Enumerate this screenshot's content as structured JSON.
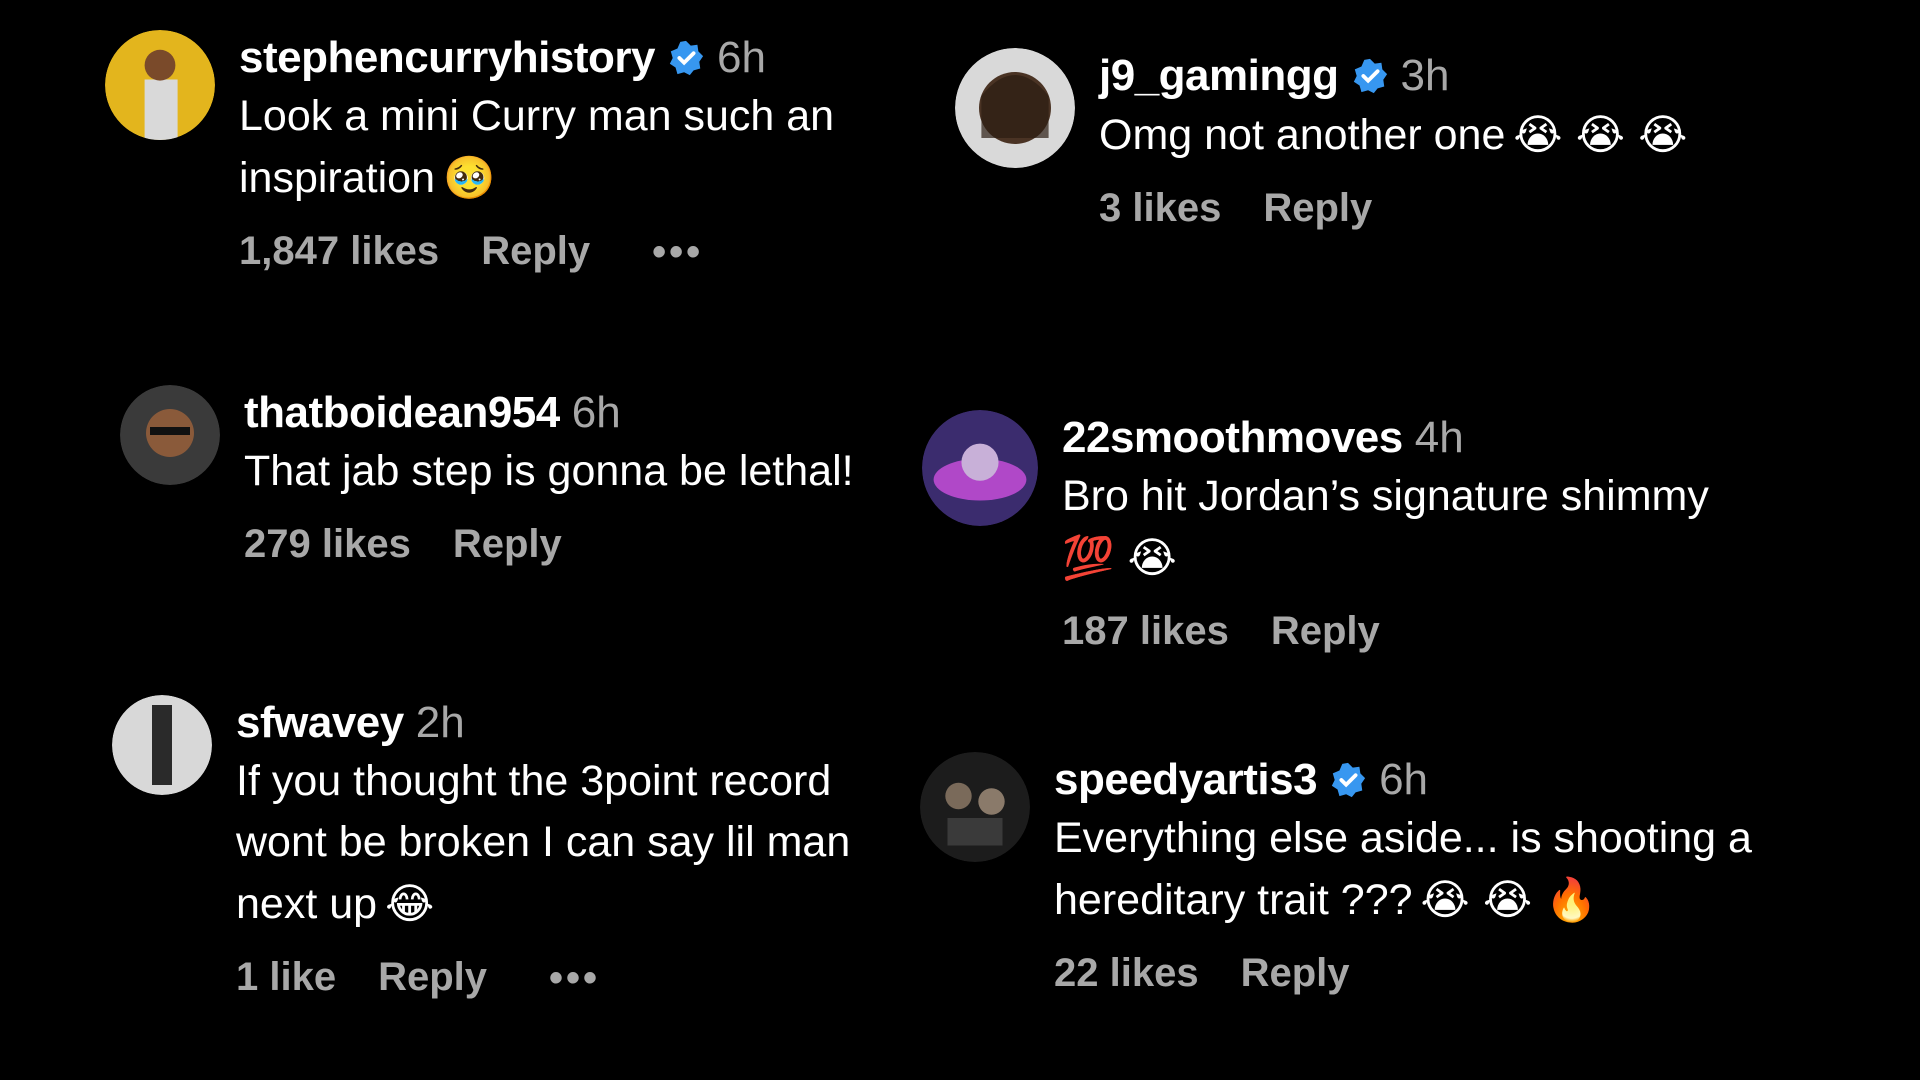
{
  "comments": [
    {
      "username": "stephencurryhistory",
      "verified": true,
      "time": "6h",
      "text": "Look a mini Curry man such an inspiration",
      "emojis": "🥹",
      "likes": "1,847 likes",
      "reply": "Reply",
      "more": "•••"
    },
    {
      "username": "thatboidean954",
      "verified": false,
      "time": "6h",
      "text": "That jab step is gonna be lethal!",
      "emojis": "",
      "likes": "279 likes",
      "reply": "Reply"
    },
    {
      "username": "sfwavey",
      "verified": false,
      "time": "2h",
      "text": "If you thought the 3point record wont be broken I can say lil man next up",
      "emojis": "😂",
      "likes": "1 like",
      "reply": "Reply",
      "more": "•••"
    },
    {
      "username": "j9_gamingg",
      "verified": true,
      "time": "3h",
      "text": "Omg not another one",
      "emojis": "😭 😭 😭",
      "likes": "3 likes",
      "reply": "Reply"
    },
    {
      "username": "22smoothmoves",
      "verified": false,
      "time": "4h",
      "text": "Bro hit Jordan’s signature shimmy",
      "emojis": "💯 😭",
      "likes": "187 likes",
      "reply": "Reply"
    },
    {
      "username": "speedyartis3",
      "verified": true,
      "time": "6h",
      "text": "Everything else aside... is shooting a hereditary trait ???",
      "emojis": "😭 😭 🔥",
      "likes": "22 likes",
      "reply": "Reply"
    }
  ],
  "colors": {
    "verified": "#3797f0",
    "muted": "#a8a8a8",
    "background": "#000000"
  },
  "icons": {
    "verified": "verified-badge-icon",
    "more": "more-options-icon"
  }
}
